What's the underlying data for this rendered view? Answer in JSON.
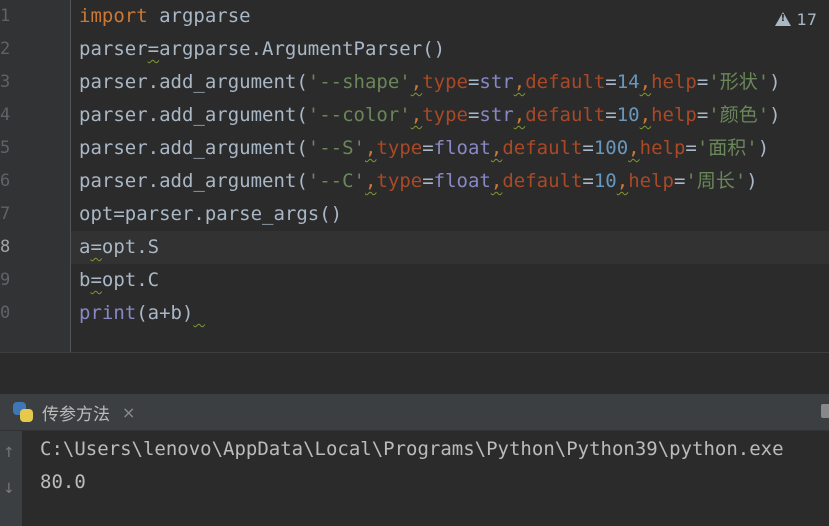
{
  "editor": {
    "line_numbers": [
      "1",
      "2",
      "3",
      "4",
      "5",
      "6",
      "7",
      "8",
      "9",
      "0"
    ],
    "active_line_index": 7,
    "inspection_count": "17",
    "lines": [
      [
        {
          "t": "import",
          "c": "kw"
        },
        {
          "t": " argparse",
          "c": ""
        }
      ],
      [
        {
          "t": "parser",
          "c": ""
        },
        {
          "t": "=",
          "c": "warn"
        },
        {
          "t": "argparse.ArgumentParser()",
          "c": ""
        }
      ],
      [
        {
          "t": "parser.add_argument(",
          "c": ""
        },
        {
          "t": "'--shape'",
          "c": "str"
        },
        {
          "t": ",",
          "c": "punct warn"
        },
        {
          "t": "type",
          "c": "param"
        },
        {
          "t": "=",
          "c": ""
        },
        {
          "t": "str",
          "c": "builtin"
        },
        {
          "t": ",",
          "c": "punct warn"
        },
        {
          "t": "default",
          "c": "param"
        },
        {
          "t": "=",
          "c": ""
        },
        {
          "t": "14",
          "c": "num-lit"
        },
        {
          "t": ",",
          "c": "punct warn"
        },
        {
          "t": "help",
          "c": "param"
        },
        {
          "t": "=",
          "c": ""
        },
        {
          "t": "'形状'",
          "c": "str"
        },
        {
          "t": ")",
          "c": ""
        }
      ],
      [
        {
          "t": "parser.add_argument(",
          "c": ""
        },
        {
          "t": "'--color'",
          "c": "str"
        },
        {
          "t": ",",
          "c": "punct warn"
        },
        {
          "t": "type",
          "c": "param"
        },
        {
          "t": "=",
          "c": ""
        },
        {
          "t": "str",
          "c": "builtin"
        },
        {
          "t": ",",
          "c": "punct warn"
        },
        {
          "t": "default",
          "c": "param"
        },
        {
          "t": "=",
          "c": ""
        },
        {
          "t": "10",
          "c": "num-lit"
        },
        {
          "t": ",",
          "c": "punct warn"
        },
        {
          "t": "help",
          "c": "param"
        },
        {
          "t": "=",
          "c": ""
        },
        {
          "t": "'颜色'",
          "c": "str"
        },
        {
          "t": ")",
          "c": ""
        }
      ],
      [
        {
          "t": "parser.add_argument(",
          "c": ""
        },
        {
          "t": "'--S'",
          "c": "str"
        },
        {
          "t": ",",
          "c": "punct warn"
        },
        {
          "t": "type",
          "c": "param"
        },
        {
          "t": "=",
          "c": ""
        },
        {
          "t": "float",
          "c": "builtin"
        },
        {
          "t": ",",
          "c": "punct warn"
        },
        {
          "t": "default",
          "c": "param"
        },
        {
          "t": "=",
          "c": ""
        },
        {
          "t": "100",
          "c": "num-lit"
        },
        {
          "t": ",",
          "c": "punct warn"
        },
        {
          "t": "help",
          "c": "param"
        },
        {
          "t": "=",
          "c": ""
        },
        {
          "t": "'面积'",
          "c": "str"
        },
        {
          "t": ")",
          "c": ""
        }
      ],
      [
        {
          "t": "parser.add_argument(",
          "c": ""
        },
        {
          "t": "'--C'",
          "c": "str"
        },
        {
          "t": ",",
          "c": "punct warn"
        },
        {
          "t": "type",
          "c": "param"
        },
        {
          "t": "=",
          "c": ""
        },
        {
          "t": "float",
          "c": "builtin"
        },
        {
          "t": ",",
          "c": "punct warn"
        },
        {
          "t": "default",
          "c": "param"
        },
        {
          "t": "=",
          "c": ""
        },
        {
          "t": "10",
          "c": "num-lit"
        },
        {
          "t": ",",
          "c": "punct warn"
        },
        {
          "t": "help",
          "c": "param"
        },
        {
          "t": "=",
          "c": ""
        },
        {
          "t": "'周长'",
          "c": "str"
        },
        {
          "t": ")",
          "c": ""
        }
      ],
      [
        {
          "t": "opt=parser.parse_args()",
          "c": ""
        }
      ],
      [
        {
          "t": "a",
          "c": ""
        },
        {
          "t": "=",
          "c": "warn"
        },
        {
          "t": "opt.S",
          "c": ""
        }
      ],
      [
        {
          "t": "b",
          "c": ""
        },
        {
          "t": "=",
          "c": "warn"
        },
        {
          "t": "opt.C",
          "c": ""
        }
      ],
      [
        {
          "t": "print",
          "c": "builtin"
        },
        {
          "t": "(a",
          "c": ""
        },
        {
          "t": "+",
          "c": ""
        },
        {
          "t": "b)",
          "c": ""
        },
        {
          "t": " ",
          "c": "warn"
        }
      ]
    ]
  },
  "run_panel": {
    "tab_label": "传参方法",
    "close_glyph": "×",
    "output_lines": [
      "C:\\Users\\lenovo\\AppData\\Local\\Programs\\Python\\Python39\\python.exe",
      "80.0"
    ]
  }
}
